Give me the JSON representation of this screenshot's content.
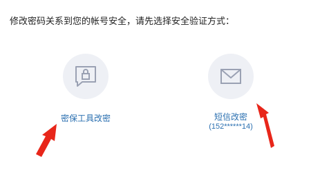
{
  "instruction": "修改密码关系到您的帐号安全，请先选择安全验证方式：",
  "options": [
    {
      "icon": "lock-chat-icon",
      "label": "密保工具改密"
    },
    {
      "icon": "envelope-icon",
      "label": "短信改密",
      "sub": "(152******14)"
    }
  ],
  "colors": {
    "link": "#2a6fb0",
    "icon_bg": "#eef0f5",
    "icon_stroke": "#9aa1b3",
    "arrow": "#e8261a"
  }
}
